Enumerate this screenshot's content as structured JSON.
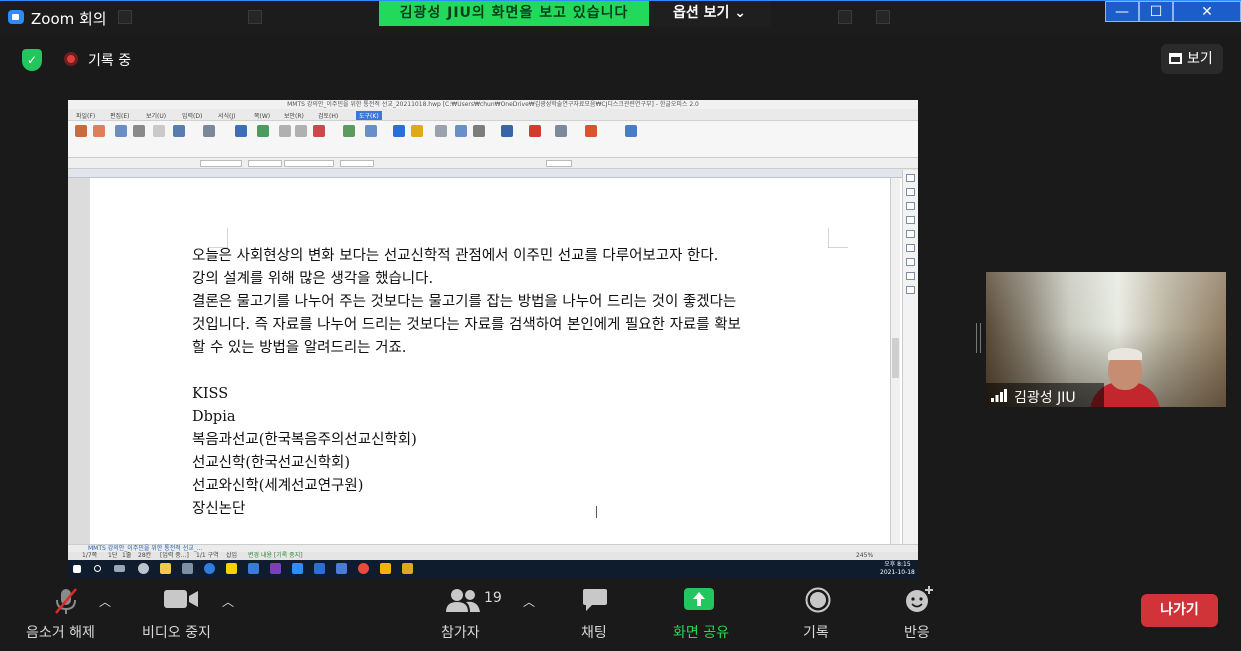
{
  "window": {
    "app_title": "Zoom 회의",
    "minimize": "—",
    "maximize": "☐",
    "close": "✕"
  },
  "share_banner": {
    "text": "김광성 JIU의 화면을 보고 있습니다",
    "options_label": "옵션 보기 ⌄"
  },
  "meeting": {
    "recording_label": "기록 중",
    "view_label": "보기"
  },
  "shared_screen": {
    "app_title": "MMTS 강의안_이주민을 위한 통전적 선교_20211018.hwp [C:₩Users₩chun₩OneDrive₩김광성학술연구자료모음₩CJ디스크관련연구부] - 한글오피스 2.0",
    "menu": [
      "파일(F)",
      "편집(E)",
      "보기(U)",
      "입력(D)",
      "서식(J)",
      "쪽(W)",
      "보안(R)",
      "검토(H)",
      "도구(K)"
    ],
    "document_tab": "MMTS 강의안_이주민을 위한 통전적 선교_...",
    "status": [
      "1/7쪽",
      "1단",
      "1줄",
      "28칸",
      "[입력 중...]",
      "1/1 구역",
      "삽입",
      "변경 내용 [기록 중지]"
    ],
    "zoom": "245%",
    "clock_time": "오후 8:15",
    "clock_date": "2021-10-18",
    "paragraphs": [
      "오늘은 사회현상의 변화 보다는 선교신학적 관점에서 이주민 선교를 다루어보고자 한다.",
      "강의 설계를 위해 많은 생각을 했습니다.",
      "결론은 물고기를 나누어 주는 것보다는 물고기를 잡는 방법을 나누어 드리는 것이 좋겠다는",
      "것입니다. 즉 자료를 나누어 드리는 것보다는 자료를 검색하여 본인에게 필요한 자료를 확보",
      "할 수 있는 방법을 알려드리는 거죠."
    ],
    "list_items": [
      "KISS",
      "Dbpia",
      "복음과선교(한국복음주의선교신학회)",
      "선교신학(한국선교신학회)",
      "선교와신학(세계선교연구원)",
      "장신논단"
    ]
  },
  "video": {
    "participant_name": "김광성 JIU"
  },
  "toolbar": {
    "unmute": "음소거 해제",
    "stop_video": "비디오 중지",
    "participants": "참가자",
    "participants_count": "19",
    "chat": "채팅",
    "share_screen": "화면 공유",
    "record": "기록",
    "reactions": "반응",
    "leave": "나가기"
  },
  "colors": {
    "accent_green": "#23d959",
    "zoom_blue": "#2d8cff",
    "leave_red": "#d13438",
    "toolbar_bg": "#1a1a1a"
  }
}
